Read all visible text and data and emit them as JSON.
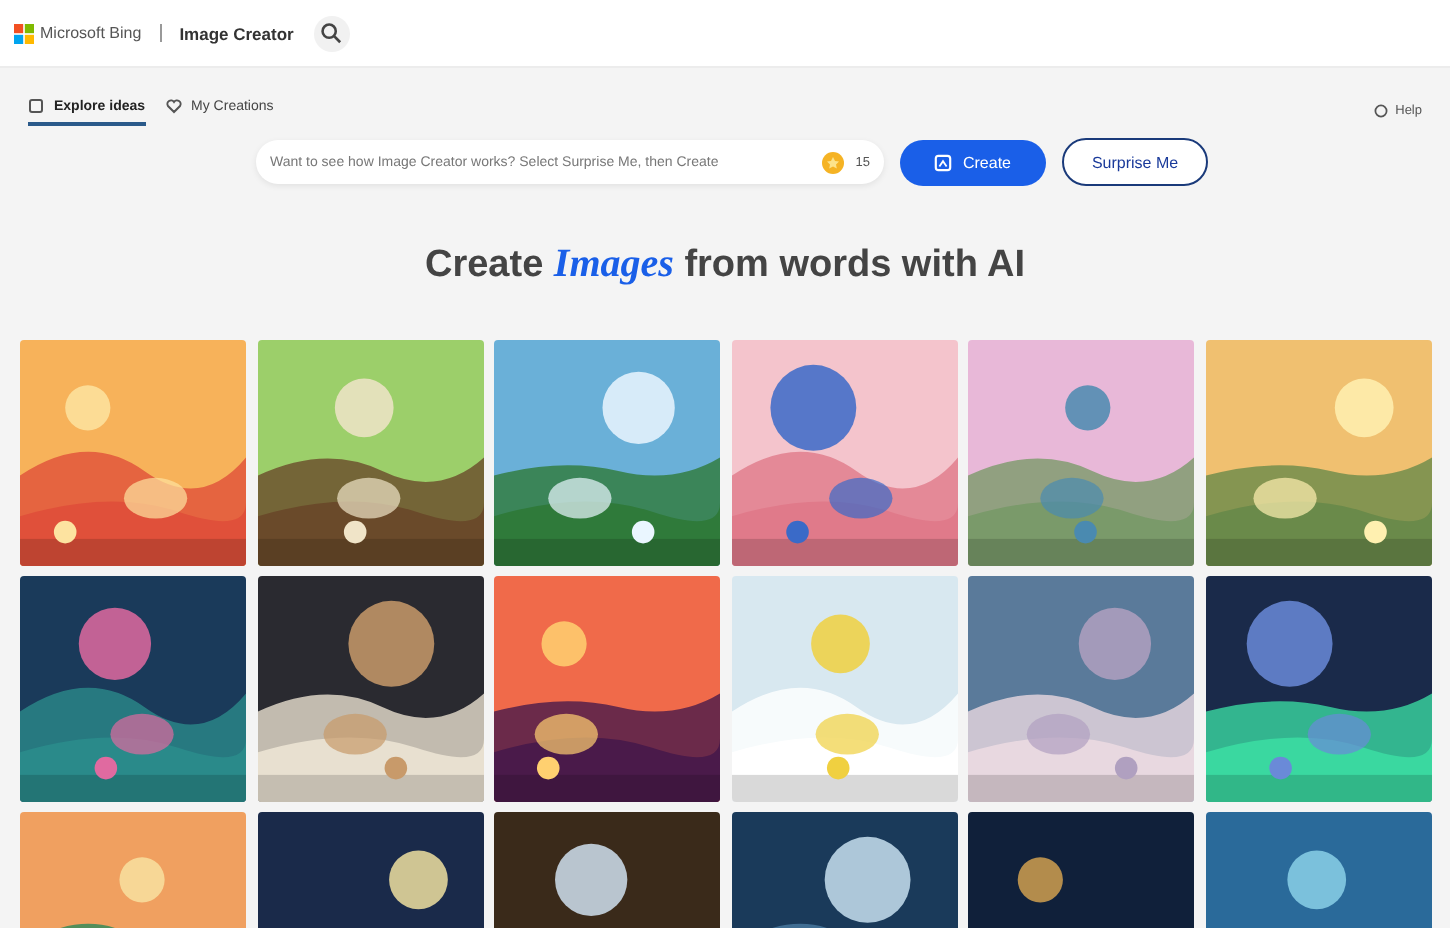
{
  "header": {
    "brand": "Microsoft Bing",
    "product": "Image Creator"
  },
  "tabs": [
    {
      "label": "Explore ideas",
      "selected": true
    },
    {
      "label": "My Creations",
      "selected": false
    }
  ],
  "help": "Help",
  "prompt": {
    "placeholder": "Want to see how Image Creator works? Select Surprise Me, then Create",
    "credits": "15"
  },
  "buttons": {
    "create": "Create",
    "surprise": "Surprise Me"
  },
  "heading": "Create *Images* from words with AI"
}
